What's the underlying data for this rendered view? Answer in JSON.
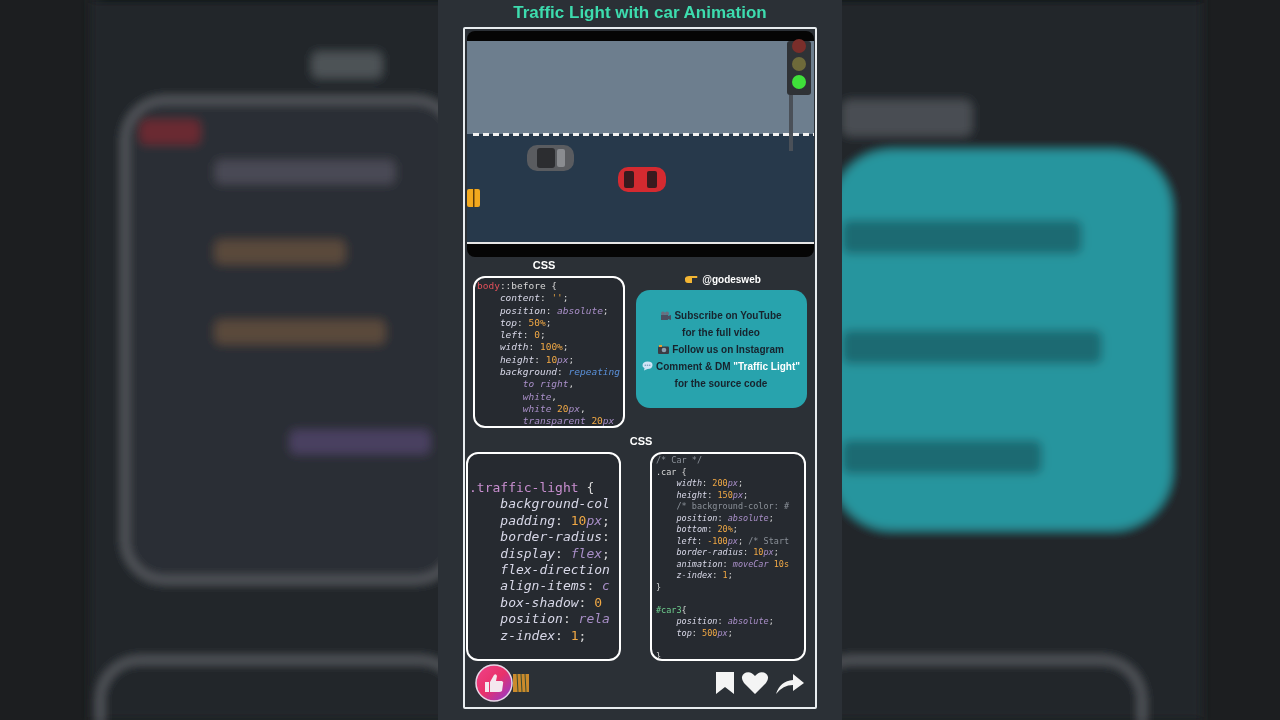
{
  "title": "Traffic Light with car Animation",
  "scene": {
    "kind": "picture",
    "lights": [
      {
        "lit": false
      },
      {
        "lit": false
      },
      {
        "lit": true
      }
    ]
  },
  "top_label": "CSS",
  "code_box_1": {
    "lines": [
      [
        {
          "text": "body",
          "kind": "sel"
        },
        {
          "text": "::before {",
          "kind": "punct"
        }
      ],
      [
        {
          "text": "    content",
          "kind": "prop"
        },
        {
          "text": ": ",
          "kind": "punct"
        },
        {
          "text": "''",
          "kind": "str"
        },
        {
          "text": ";",
          "kind": "punct"
        }
      ],
      [
        {
          "text": "    position",
          "kind": "prop"
        },
        {
          "text": ": ",
          "kind": "punct"
        },
        {
          "text": "absolute",
          "kind": "val"
        },
        {
          "text": ";",
          "kind": "punct"
        }
      ],
      [
        {
          "text": "    top",
          "kind": "prop"
        },
        {
          "text": ": ",
          "kind": "punct"
        },
        {
          "text": "50%",
          "kind": "num"
        },
        {
          "text": ";",
          "kind": "punct"
        }
      ],
      [
        {
          "text": "    left",
          "kind": "prop"
        },
        {
          "text": ": ",
          "kind": "punct"
        },
        {
          "text": "0",
          "kind": "num"
        },
        {
          "text": ";",
          "kind": "punct"
        }
      ],
      [
        {
          "text": "    width",
          "kind": "prop"
        },
        {
          "text": ": ",
          "kind": "punct"
        },
        {
          "text": "100%",
          "kind": "num"
        },
        {
          "text": ";",
          "kind": "punct"
        }
      ],
      [
        {
          "text": "    height",
          "kind": "prop"
        },
        {
          "text": ": ",
          "kind": "punct"
        },
        {
          "text": "10",
          "kind": "num"
        },
        {
          "text": "px",
          "kind": "unit"
        },
        {
          "text": ";",
          "kind": "punct"
        }
      ],
      [
        {
          "text": "    background",
          "kind": "prop"
        },
        {
          "text": ": ",
          "kind": "punct"
        },
        {
          "text": "repeating",
          "kind": "func"
        }
      ],
      [
        {
          "text": "        to right",
          "kind": "val"
        },
        {
          "text": ",",
          "kind": "punct"
        }
      ],
      [
        {
          "text": "        white",
          "kind": "val"
        },
        {
          "text": ",",
          "kind": "punct"
        }
      ],
      [
        {
          "text": "        white ",
          "kind": "val"
        },
        {
          "text": "20",
          "kind": "num"
        },
        {
          "text": "px",
          "kind": "unit"
        },
        {
          "text": ",",
          "kind": "punct"
        }
      ],
      [
        {
          "text": "        transparent ",
          "kind": "val"
        },
        {
          "text": "20",
          "kind": "num"
        },
        {
          "text": "px",
          "kind": "unit"
        }
      ]
    ]
  },
  "promo": {
    "handle": "@godesweb",
    "lines": [
      [
        {
          "text": "Subscribe on YouTube",
          "kind": "film"
        }
      ],
      [
        {
          "text": "for the full video"
        }
      ],
      [
        {
          "text": "Follow us on Instagram",
          "kind": "camera"
        }
      ],
      [
        {
          "text": "Comment & DM ",
          "kind": "speech"
        },
        {
          "text": "\"Traffic Light\"",
          "highlight": true
        }
      ],
      [
        {
          "text": "for the source code"
        }
      ]
    ]
  },
  "middle_label": "CSS",
  "code_box_2": {
    "lines": [
      [
        {
          "text": ".traffic-light",
          "kind": "cls"
        },
        {
          "text": " {",
          "kind": "punct"
        }
      ],
      [
        {
          "text": "    background-col",
          "kind": "prop"
        }
      ],
      [
        {
          "text": "    padding",
          "kind": "prop"
        },
        {
          "text": ": ",
          "kind": "punct"
        },
        {
          "text": "10",
          "kind": "num"
        },
        {
          "text": "px",
          "kind": "unit"
        },
        {
          "text": ";",
          "kind": "punct"
        }
      ],
      [
        {
          "text": "    border-radius",
          "kind": "prop"
        },
        {
          "text": ":",
          "kind": "punct"
        }
      ],
      [
        {
          "text": "    display",
          "kind": "prop"
        },
        {
          "text": ": ",
          "kind": "punct"
        },
        {
          "text": "flex",
          "kind": "val"
        },
        {
          "text": ";",
          "kind": "punct"
        }
      ],
      [
        {
          "text": "    flex-direction",
          "kind": "prop"
        }
      ],
      [
        {
          "text": "    align-items",
          "kind": "prop"
        },
        {
          "text": ": ",
          "kind": "punct"
        },
        {
          "text": "c",
          "kind": "val"
        }
      ],
      [
        {
          "text": "    box-shadow",
          "kind": "prop"
        },
        {
          "text": ": ",
          "kind": "punct"
        },
        {
          "text": "0",
          "kind": "num"
        }
      ],
      [
        {
          "text": "    position",
          "kind": "prop"
        },
        {
          "text": ": ",
          "kind": "punct"
        },
        {
          "text": "rela",
          "kind": "val"
        }
      ],
      [
        {
          "text": "    z-index",
          "kind": "prop"
        },
        {
          "text": ": ",
          "kind": "punct"
        },
        {
          "text": "1",
          "kind": "num"
        },
        {
          "text": ";",
          "kind": "punct"
        }
      ]
    ]
  },
  "code_box_3": {
    "blocks": [
      [
        [
          {
            "text": "/* Car */",
            "kind": "comment"
          }
        ],
        [
          {
            "text": ".car {",
            "kind": "punct"
          }
        ],
        [
          {
            "text": "    width",
            "kind": "prop"
          },
          {
            "text": ": ",
            "kind": "punct"
          },
          {
            "text": "200",
            "kind": "num"
          },
          {
            "text": "px",
            "kind": "unit"
          },
          {
            "text": ";",
            "kind": "punct"
          }
        ],
        [
          {
            "text": "    height",
            "kind": "prop"
          },
          {
            "text": ": ",
            "kind": "punct"
          },
          {
            "text": "150",
            "kind": "num"
          },
          {
            "text": "px",
            "kind": "unit"
          },
          {
            "text": ";",
            "kind": "punct"
          }
        ],
        [
          {
            "text": "    /* background-color: #",
            "kind": "comment"
          }
        ],
        [
          {
            "text": "    position",
            "kind": "prop"
          },
          {
            "text": ": ",
            "kind": "punct"
          },
          {
            "text": "absolute",
            "kind": "val"
          },
          {
            "text": ";",
            "kind": "punct"
          }
        ],
        [
          {
            "text": "    bottom",
            "kind": "prop"
          },
          {
            "text": ": ",
            "kind": "punct"
          },
          {
            "text": "20%",
            "kind": "num"
          },
          {
            "text": ";",
            "kind": "punct"
          }
        ],
        [
          {
            "text": "    left",
            "kind": "prop"
          },
          {
            "text": ": ",
            "kind": "punct"
          },
          {
            "text": "-100",
            "kind": "num"
          },
          {
            "text": "px",
            "kind": "unit"
          },
          {
            "text": "; ",
            "kind": "punct"
          },
          {
            "text": "/* Start",
            "kind": "comment"
          }
        ],
        [
          {
            "text": "    border-radius",
            "kind": "prop"
          },
          {
            "text": ": ",
            "kind": "punct"
          },
          {
            "text": "10",
            "kind": "num"
          },
          {
            "text": "px",
            "kind": "unit"
          },
          {
            "text": ";",
            "kind": "punct"
          }
        ],
        [
          {
            "text": "    animation",
            "kind": "prop"
          },
          {
            "text": ": ",
            "kind": "punct"
          },
          {
            "text": "moveCar ",
            "kind": "val"
          },
          {
            "text": "10s",
            "kind": "num"
          }
        ],
        [
          {
            "text": "    z-index",
            "kind": "prop"
          },
          {
            "text": ": ",
            "kind": "punct"
          },
          {
            "text": "1",
            "kind": "num"
          },
          {
            "text": ";",
            "kind": "punct"
          }
        ],
        [
          {
            "text": "}",
            "kind": "punct"
          }
        ]
      ],
      [
        [
          {
            "text": "#car3",
            "kind": "id"
          },
          {
            "text": "{",
            "kind": "punct"
          }
        ],
        [
          {
            "text": "    position",
            "kind": "prop"
          },
          {
            "text": ": ",
            "kind": "punct"
          },
          {
            "text": "absolute",
            "kind": "val"
          },
          {
            "text": ";",
            "kind": "punct"
          }
        ],
        [
          {
            "text": "    top",
            "kind": "prop"
          },
          {
            "text": ": ",
            "kind": "punct"
          },
          {
            "text": "500",
            "kind": "num"
          },
          {
            "text": "px",
            "kind": "unit"
          },
          {
            "text": ";",
            "kind": "punct"
          }
        ]
      ],
      [
        [
          {
            "text": "}",
            "kind": "punct"
          }
        ]
      ]
    ]
  }
}
